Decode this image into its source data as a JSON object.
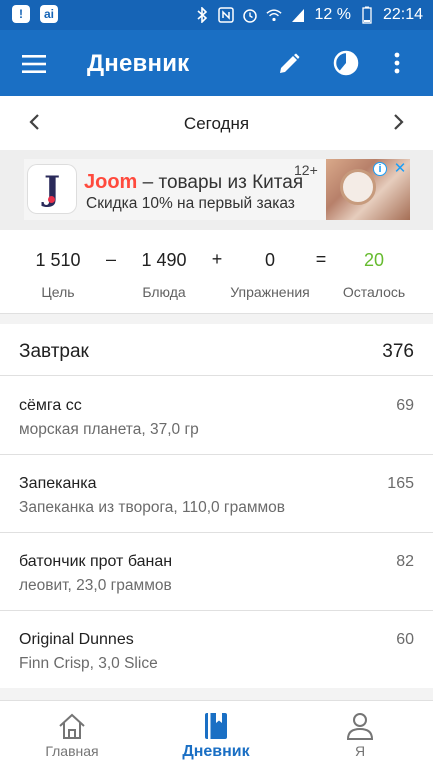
{
  "status_bar": {
    "battery": "12 %",
    "time": "22:14",
    "left_badge": "!",
    "left_app": "ai"
  },
  "app_bar": {
    "title": "Дневник",
    "menu_icon": "menu-icon",
    "edit_icon": "pencil-icon",
    "chart_icon": "pie-chart-icon",
    "more_icon": "more-vert-icon"
  },
  "date_nav": {
    "label": "Сегодня"
  },
  "ad": {
    "brand": "Joom",
    "line1_rest": " – товары из Китая",
    "line2": "Скидка 10% на первый заказ",
    "age": "12+"
  },
  "summary": {
    "goal_value": "1 510",
    "goal_label": "Цель",
    "op_minus": "–",
    "food_value": "1 490",
    "food_label": "Блюда",
    "op_plus": "+",
    "exercise_value": "0",
    "exercise_label": "Упражнения",
    "op_equals": "=",
    "remaining_value": "20",
    "remaining_label": "Осталось",
    "remaining_color": "#66bb2f"
  },
  "meal": {
    "title": "Завтрак",
    "total": "376",
    "items": [
      {
        "name": "сёмга сс",
        "desc": "морская планета, 37,0 гр",
        "cal": "69"
      },
      {
        "name": "Запеканка",
        "desc": "Запеканка из творога, 110,0 граммов",
        "cal": "165"
      },
      {
        "name": "батончик прот банан",
        "desc": "леовит, 23,0 граммов",
        "cal": "82"
      },
      {
        "name": "Original Dunnes",
        "desc": "Finn Crisp, 3,0 Slice",
        "cal": "60"
      }
    ]
  },
  "bottom_nav": {
    "items": [
      {
        "label": "Главная",
        "icon": "home-icon"
      },
      {
        "label": "Дневник",
        "icon": "diary-icon"
      },
      {
        "label": "Я",
        "icon": "person-icon"
      }
    ],
    "active_color": "#1a6fc4"
  },
  "colors": {
    "primary": "#1a6fc4",
    "status_bar": "#1664b6"
  }
}
